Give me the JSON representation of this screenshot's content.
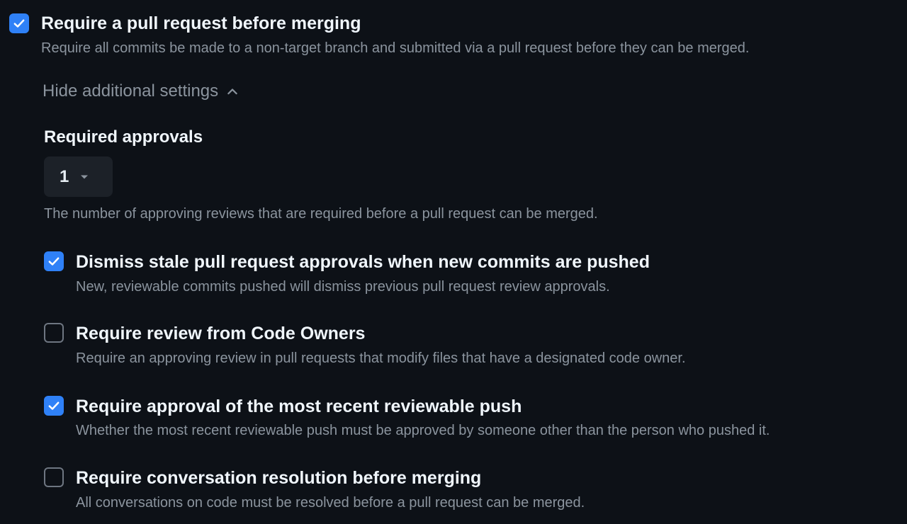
{
  "main_rule": {
    "checked": true,
    "title": "Require a pull request before merging",
    "description": "Require all commits be made to a non-target branch and submitted via a pull request before they can be merged."
  },
  "additional_settings_toggle": {
    "label": "Hide additional settings",
    "icon": "chevron-up-icon"
  },
  "required_approvals": {
    "label": "Required approvals",
    "selected_value": "1",
    "help_text": "The number of approving reviews that are required before a pull request can be merged."
  },
  "options": [
    {
      "checked": true,
      "title": "Dismiss stale pull request approvals when new commits are pushed",
      "description": "New, reviewable commits pushed will dismiss previous pull request review approvals."
    },
    {
      "checked": false,
      "title": "Require review from Code Owners",
      "description": "Require an approving review in pull requests that modify files that have a designated code owner."
    },
    {
      "checked": true,
      "title": "Require approval of the most recent reviewable push",
      "description": "Whether the most recent reviewable push must be approved by someone other than the person who pushed it."
    },
    {
      "checked": false,
      "title": "Require conversation resolution before merging",
      "description": "All conversations on code must be resolved before a pull request can be merged."
    }
  ],
  "colors": {
    "background": "#0d1117",
    "checkbox_accent": "#2f81f7",
    "title_text": "#f0f6fc",
    "muted_text": "#8b949e",
    "select_background": "#1c2128"
  }
}
